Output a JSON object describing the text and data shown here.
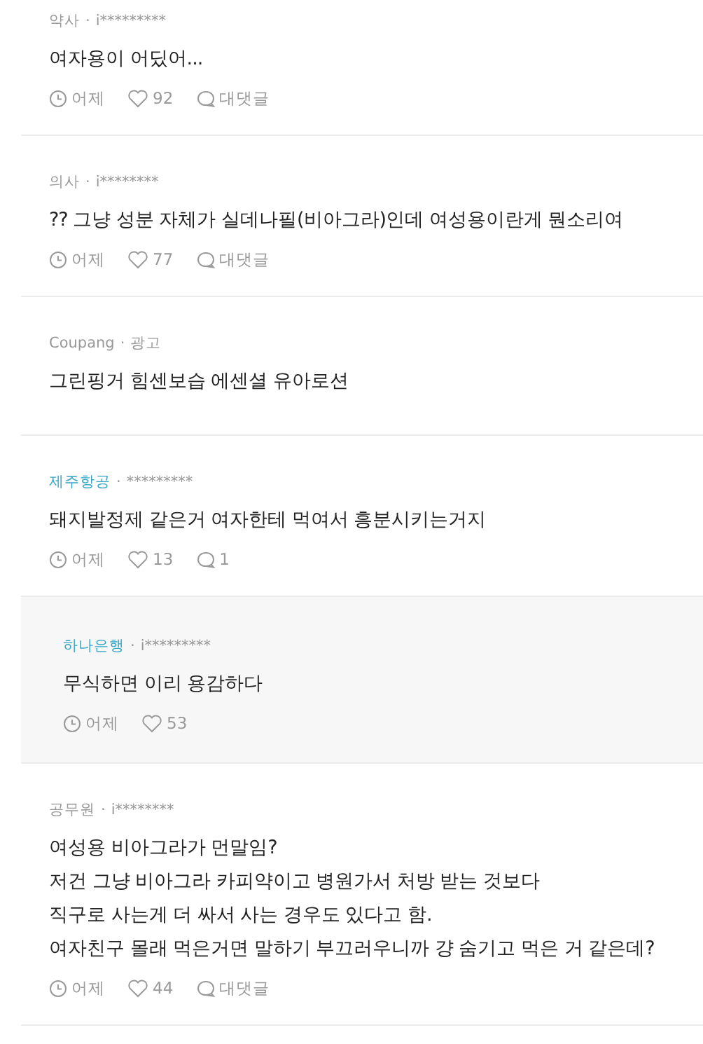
{
  "separator": "·",
  "comments": [
    {
      "kind": "comment",
      "company": "약사",
      "verified": false,
      "user": "i*********",
      "lines": [
        "여자용이 어딨어..."
      ],
      "time": "어제",
      "likes": "92",
      "replies": "대댓글"
    },
    {
      "kind": "comment",
      "company": "의사",
      "verified": false,
      "user": "i********",
      "lines": [
        "?? 그냥 성분 자체가 실데나필(비아그라)인데 여성용이란게 뭔소리여"
      ],
      "time": "어제",
      "likes": "77",
      "replies": "대댓글"
    },
    {
      "kind": "ad",
      "company": "Coupang",
      "verified": false,
      "user": "광고",
      "lines": [
        "그린핑거 힘센보습 에센셜 유아로션"
      ]
    },
    {
      "kind": "comment",
      "company": "제주항공",
      "verified": true,
      "user": "*********",
      "lines": [
        "돼지발정제 같은거 여자한테 먹여서 흥분시키는거지"
      ],
      "time": "어제",
      "likes": "13",
      "replies": "1"
    },
    {
      "kind": "reply",
      "company": "하나은행",
      "verified": true,
      "user": "i*********",
      "lines": [
        "무식하면 이리 용감하다"
      ],
      "time": "어제",
      "likes": "53"
    },
    {
      "kind": "comment",
      "company": "공무원",
      "verified": false,
      "user": "i********",
      "lines": [
        "여성용 비아그라가 먼말임?",
        "저건 그냥 비아그라 카피약이고 병원가서 처방 받는 것보다",
        "직구로 사는게 더 싸서 사는 경우도 있다고 함.",
        "여자친구 몰래 먹은거면 말하기 부끄러우니까 걍 숨기고 먹은 거 같은데?"
      ],
      "time": "어제",
      "likes": "44",
      "replies": "대댓글"
    }
  ]
}
